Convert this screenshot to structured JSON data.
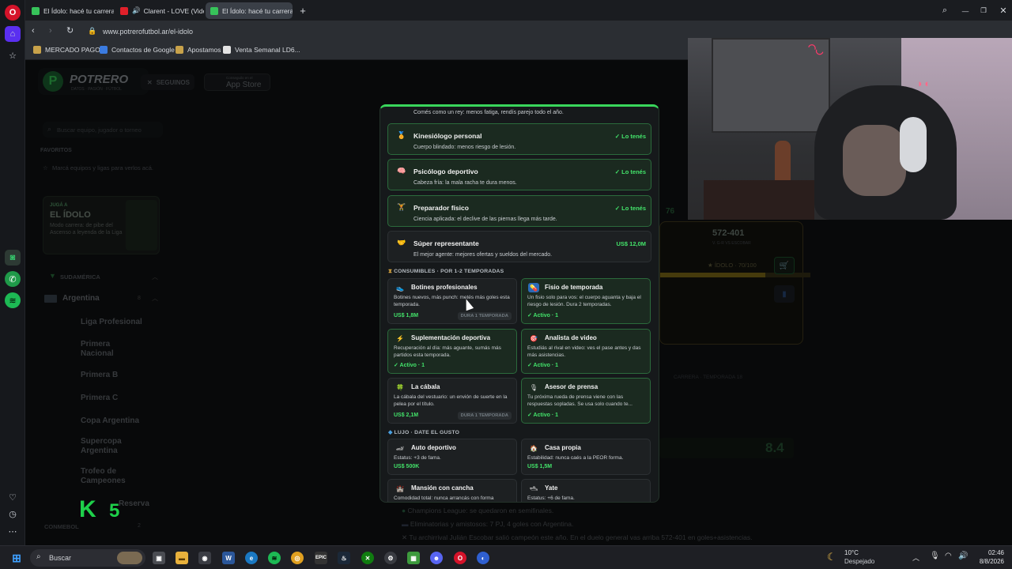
{
  "browser": {
    "tabs": [
      {
        "label": "El Ídolo: hacé tu carrera e"
      },
      {
        "label": "Clarent - LOVE (Video"
      },
      {
        "label": "El Ídolo: hacé tu carrera e"
      }
    ],
    "url": "www.potrerofutbol.ar/el-idolo",
    "bookmarks": [
      "MERCADO PAGO",
      "Contactos de Google",
      "Apostamos",
      "Venta Semanal LD6..."
    ]
  },
  "site": {
    "logo": "POTRERO",
    "logo_sub": "DATOS · PASIÓN · FÚTBOL",
    "follow_label": "SEGUINOS",
    "store_small": "Conseguilo en el",
    "store": "App Store",
    "search_placeholder": "Buscar equipo, jugador o torneo",
    "favorites_title": "FAVORITOS",
    "favorites_empty": "Marcá equipos y ligas para verlos acá.",
    "promo_small": "JUGÁ A",
    "promo_title": "EL ÍDOLO",
    "promo_desc": "Modo carrera: de pibe del Ascenso a leyenda de la Liga",
    "region": "SUDAMÉRICA",
    "country": "Argentina",
    "country_count": "8",
    "leagues": [
      "Liga Profesional",
      "Primera Nacional",
      "Primera B",
      "Primera C",
      "Copa Argentina",
      "Supercopa Argentina",
      "Trofeo de Campeones",
      "Reserva"
    ],
    "conmebol": "CONMEBOL",
    "conmebol_count": "2",
    "right_score": "572-401",
    "right_score_label": "V. G-R VS ESCOBAR",
    "idolo_label": "ÍDOLO · 70/100",
    "rating_76": "76",
    "season_label": "CARRERA · TEMPORADA 18",
    "rating_84": "8.4",
    "news": [
      "Champions League: se quedaron en semifinales.",
      "Eliminatorias y amistosos: 7 PJ, 4 goles con Argentina.",
      "Tu archirrival Julián Escobar salió campeón este año. En el duelo general vas arriba 572-401 en goles+asistencias."
    ]
  },
  "modal": {
    "top_desc": "Comés como un rey: menos fatiga, rendís parejo todo el año.",
    "staff": [
      {
        "icon": "🏅",
        "title": "Kinesiólogo personal",
        "desc": "Cuerpo blindado: menos riesgo de lesión.",
        "status": "✓ Lo tenés",
        "owned": true
      },
      {
        "icon": "🧠",
        "title": "Psicólogo deportivo",
        "desc": "Cabeza fría: la mala racha te dura menos.",
        "status": "✓ Lo tenés",
        "owned": true
      },
      {
        "icon": "🏋",
        "title": "Preparador físico",
        "desc": "Ciencia aplicada: el declive de las piernas llega más tarde.",
        "status": "✓ Lo tenés",
        "owned": true
      },
      {
        "icon": "🤝",
        "title": "Súper representante",
        "desc": "El mejor agente: mejores ofertas y sueldos del mercado.",
        "status": "US$ 12,0M",
        "owned": false
      }
    ],
    "consumables_title": "CONSUMIBLES · POR 1-2 TEMPORADAS",
    "consumables": [
      {
        "icon": "👟",
        "title": "Botines profesionales",
        "desc": "Botines nuevos, más punch: metés más goles esta temporada.",
        "price": "US$ 1,8M",
        "duration": "DURA 1 TEMPORADA",
        "active": false
      },
      {
        "icon": "💊",
        "title": "Fisio de temporada",
        "desc": "Un fisio solo para vos: el cuerpo aguanta y baja el riesgo de lesión. Dura 2 temporadas.",
        "price": "✓ Activo · 1",
        "duration": "",
        "active": true
      },
      {
        "icon": "⚡",
        "title": "Suplementación deportiva",
        "desc": "Recuperación al día: más aguante, sumás más partidos esta temporada.",
        "price": "✓ Activo · 1",
        "duration": "",
        "active": true
      },
      {
        "icon": "🎯",
        "title": "Analista de video",
        "desc": "Estudiás al rival en video: ves el pase antes y das más asistencias.",
        "price": "✓ Activo · 1",
        "duration": "",
        "active": true
      },
      {
        "icon": "🍀",
        "title": "La cábala",
        "desc": "La cábala del vestuario: un envión de suerte en la pelea por el título.",
        "price": "US$ 2,1M",
        "duration": "DURA 1 TEMPORADA",
        "active": false
      },
      {
        "icon": "🎙",
        "title": "Asesor de prensa",
        "desc": "Tu próxima rueda de prensa viene con las respuestas sopladas. Se usa solo cuando te...",
        "price": "✓ Activo · 1",
        "duration": "",
        "active": true
      }
    ],
    "luxury_title": "LUJO · DATE EL GUSTO",
    "luxury": [
      {
        "icon": "🏎",
        "title": "Auto deportivo",
        "desc": "Estatus: +3 de fama.",
        "price": "US$ 500K"
      },
      {
        "icon": "🏠",
        "title": "Casa propia",
        "desc": "Estabilidad: nunca caés a la PEOR forma.",
        "price": "US$ 1,5M"
      },
      {
        "icon": "🏰",
        "title": "Mansión con cancha",
        "desc": "Comodidad total: nunca arrancás con forma",
        "price": ""
      },
      {
        "icon": "🛥",
        "title": "Yate",
        "desc": "Estatus: +6 de fama.",
        "price": ""
      }
    ]
  },
  "overlay": {
    "k": "K",
    "n": "5"
  },
  "taskbar": {
    "search": "Buscar",
    "weather_temp": "10°C",
    "weather_desc": "Despejado",
    "time": "02:46",
    "date": "8/8/2026"
  },
  "colors": {
    "accent_green": "#39d65b",
    "owned_green": "#43e36a"
  }
}
